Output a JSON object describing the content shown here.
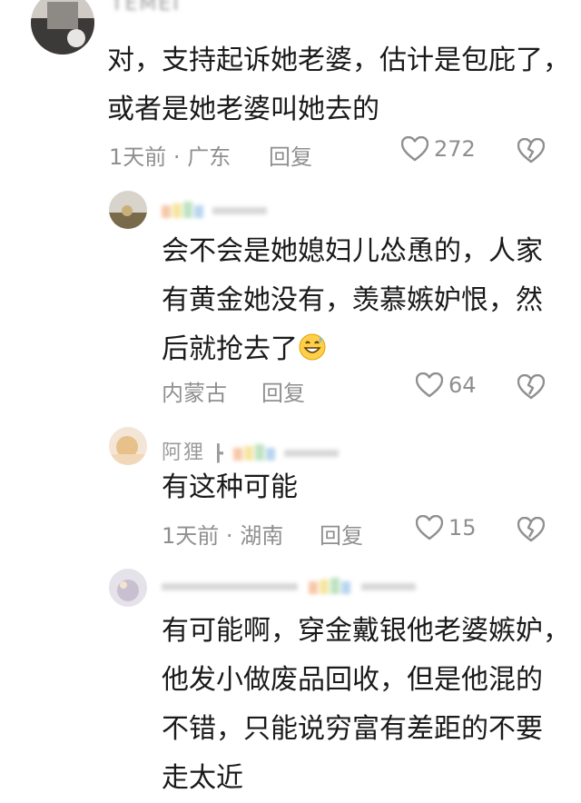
{
  "comments": [
    {
      "username": "TEMEI",
      "text_lines": [
        "对，支持起诉她老婆，估计是包庇了，",
        "或者是她老婆叫她去的"
      ],
      "time": "1天前",
      "location": "广东",
      "reply_label": "回复",
      "likes": "272"
    },
    {
      "username": "",
      "text_lines": [
        "会不会是她媳妇儿怂恿的，人家",
        "有黄金她没有，羡慕嫉妒恨，然",
        "后就抢去了"
      ],
      "time": "",
      "location": "内蒙古",
      "reply_label": "回复",
      "likes": "64",
      "emoji": "grin-sweat-emoji"
    },
    {
      "username": "阿狸",
      "username_suffix": "┣",
      "text_lines": [
        "有这种可能"
      ],
      "time": "1天前",
      "location": "湖南",
      "reply_label": "回复",
      "likes": "15"
    },
    {
      "username": "",
      "text_lines": [
        "有可能啊，穿金戴银他老婆嫉妒，",
        "他发小做废品回收，但是他混的",
        "不错，只能说穷富有差距的不要",
        "走太近"
      ],
      "time": "",
      "location": "",
      "reply_label": "",
      "likes": ""
    }
  ],
  "separator": "·",
  "colors": {
    "text": "#1a1a1a",
    "meta": "#8f8f8f",
    "icon": "#8f8f8f",
    "rainbow": [
      "#f7c8a8",
      "#f5e6a0",
      "#bfe3c2",
      "#b8d6f0"
    ]
  }
}
